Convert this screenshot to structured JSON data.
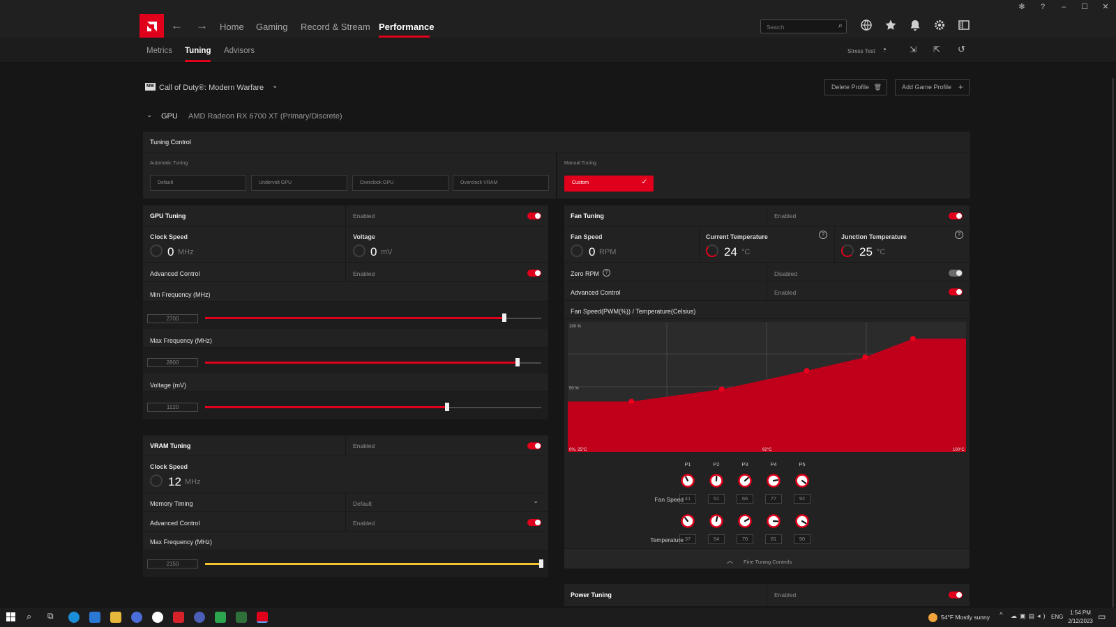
{
  "window": {
    "controls": [
      "minimize",
      "maximize",
      "close"
    ]
  },
  "topnav": {
    "items": [
      "Home",
      "Gaming",
      "Record & Stream",
      "Performance"
    ],
    "active": "Performance",
    "search_placeholder": "Search"
  },
  "subnav": {
    "items": [
      "Metrics",
      "Tuning",
      "Advisors"
    ],
    "active": "Tuning",
    "stress_test": "Stress Test"
  },
  "profile": {
    "game": "Call of Duty®: Modern Warfare",
    "delete": "Delete Profile",
    "add": "Add Game Profile"
  },
  "gpu": {
    "label": "GPU",
    "name": "AMD Radeon RX 6700 XT (Primary/Discrete)"
  },
  "tuning_control": {
    "title": "Tuning Control",
    "automatic_label": "Automatic Tuning",
    "automatic_options": [
      "Default",
      "Undervolt GPU",
      "Overclock GPU",
      "Overclock VRAM"
    ],
    "manual_label": "Manual Tuning",
    "manual_option": "Custom"
  },
  "gpu_tuning": {
    "title": "GPU Tuning",
    "state": "Enabled",
    "enabled": true,
    "clock_label": "Clock Speed",
    "clock_value": "0",
    "clock_unit": "MHz",
    "voltage_label": "Voltage",
    "voltage_value": "0",
    "voltage_unit": "mV",
    "advanced_label": "Advanced Control",
    "advanced_state": "Enabled",
    "advanced_enabled": true,
    "sliders": [
      {
        "label": "Min Frequency (MHz)",
        "value": "2700",
        "fraction": 0.89
      },
      {
        "label": "Max Frequency (MHz)",
        "value": "2800",
        "fraction": 0.93
      },
      {
        "label": "Voltage (mV)",
        "value": "1120",
        "fraction": 0.72
      }
    ]
  },
  "vram_tuning": {
    "title": "VRAM Tuning",
    "state": "Enabled",
    "enabled": true,
    "clock_label": "Clock Speed",
    "clock_value": "12",
    "clock_unit": "MHz",
    "memory_timing_label": "Memory Timing",
    "memory_timing_value": "Default",
    "advanced_label": "Advanced Control",
    "advanced_state": "Enabled",
    "advanced_enabled": true,
    "max_freq_label": "Max Frequency (MHz)",
    "max_freq_value": "2150",
    "max_freq_fraction": 1.0
  },
  "fan_tuning": {
    "title": "Fan Tuning",
    "state": "Enabled",
    "enabled": true,
    "fan_speed_label": "Fan Speed",
    "fan_speed_value": "0",
    "fan_speed_unit": "RPM",
    "current_temp_label": "Current Temperature",
    "current_temp_value": "24",
    "temp_unit": "°C",
    "junction_temp_label": "Junction Temperature",
    "junction_temp_value": "25",
    "zero_rpm_label": "Zero RPM",
    "zero_rpm_state": "Disabled",
    "zero_rpm_enabled": false,
    "advanced_label": "Advanced Control",
    "advanced_state": "Enabled",
    "advanced_enabled": true,
    "curve_title": "Fan Speed(PWM(%)) / Temperature(Celsius)",
    "fine_tuning": "Fine Tuning Controls",
    "fan_speed_row": "Fan Speed",
    "temperature_row": "Temperature"
  },
  "chart_data": {
    "type": "area",
    "labels": {
      "y_top": "100 %",
      "y_mid": "50 %",
      "x_start": "0%, 25°C",
      "x_mid": "62°C",
      "x_end": "100°C"
    },
    "points": [
      "P1",
      "P2",
      "P3",
      "P4",
      "P5"
    ],
    "fan_speed": [
      41,
      51,
      66,
      77,
      92
    ],
    "temperature": [
      37,
      54,
      70,
      81,
      90
    ],
    "x_range": [
      25,
      100
    ],
    "y_range": [
      0,
      100
    ]
  },
  "power_tuning": {
    "title": "Power Tuning",
    "state": "Enabled",
    "enabled": true
  },
  "taskbar": {
    "weather": "54°F  Mostly sunny",
    "lang": "ENG",
    "time": "1:54 PM",
    "date": "2/12/2023"
  },
  "colors": {
    "accent": "#e0001b",
    "vram_accent": "#f2c230",
    "bg": "#161616",
    "panel": "#222222"
  }
}
